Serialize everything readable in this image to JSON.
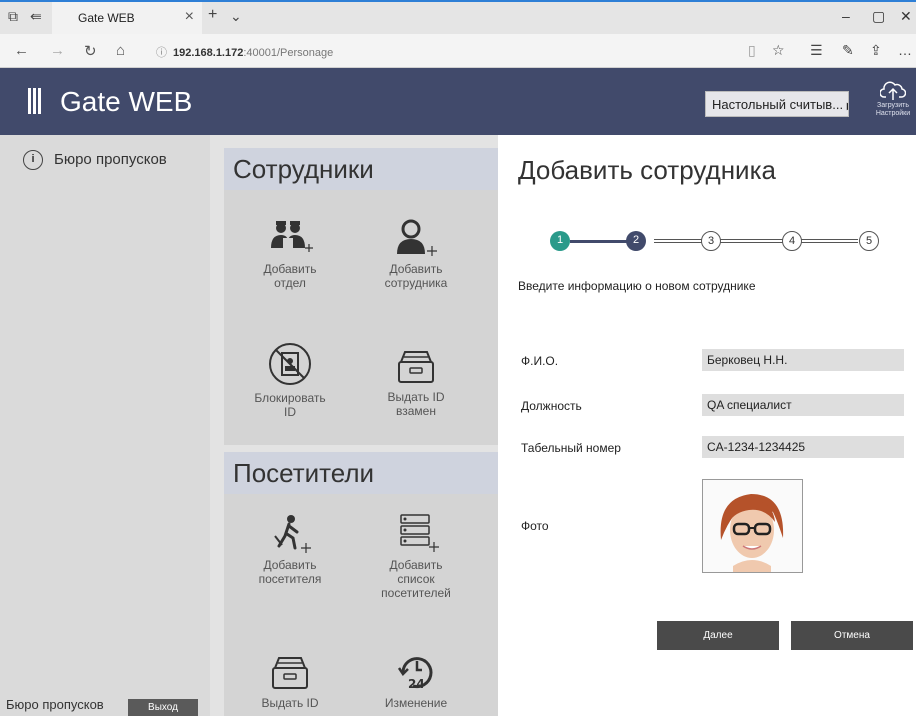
{
  "browser": {
    "tab_title": "Gate WEB",
    "url_host": "192.168.1.172",
    "url_rest": ":40001/Personage"
  },
  "header": {
    "app_title": "Gate WEB",
    "reader_select": "Настольный считыв...",
    "upload_label_1": "Загрузить",
    "upload_label_2": "Настройки"
  },
  "sidebar": {
    "item": "Бюро пропусков",
    "footer_label": "Бюро пропусков",
    "exit_button": "Выход"
  },
  "employees": {
    "heading": "Сотрудники",
    "tiles": [
      {
        "label_1": "Добавить",
        "label_2": "отдел",
        "icon": "add-department-icon"
      },
      {
        "label_1": "Добавить",
        "label_2": "сотрудника",
        "icon": "add-employee-icon"
      },
      {
        "label_1": "Блокировать",
        "label_2": "ID",
        "icon": "block-id-icon"
      },
      {
        "label_1": "Выдать ID",
        "label_2": "взамен",
        "icon": "issue-id-icon"
      }
    ]
  },
  "visitors": {
    "heading": "Посетители",
    "tiles": [
      {
        "label_1": "Добавить",
        "label_2": "посетителя",
        "icon": "add-visitor-icon"
      },
      {
        "label_1": "Добавить",
        "label_2": "список",
        "label_3": "посетителей",
        "icon": "add-visitor-list-icon"
      },
      {
        "label_1": "Выдать ID",
        "icon": "issue-id-icon"
      },
      {
        "label_1": "Изменение",
        "icon": "clock-24-icon"
      }
    ]
  },
  "form": {
    "title": "Добавить сотрудника",
    "steps": [
      "1",
      "2",
      "3",
      "4",
      "5"
    ],
    "current_step": 2,
    "instruction": "Введите информацию о новом сотруднике",
    "fields": [
      {
        "label": "Ф.И.О.",
        "value": "Берковец Н.Н."
      },
      {
        "label": "Должность",
        "value": "QA специалист"
      },
      {
        "label": "Табельный номер",
        "value": "CA-1234-1234425"
      }
    ],
    "photo_label": "Фото",
    "next_button": "Далее",
    "cancel_button": "Отмена"
  },
  "colors": {
    "header_bg": "#414a6b",
    "step_done": "#2a9a8a",
    "step_current": "#414a6b",
    "button_bg": "#4a4a4a"
  }
}
